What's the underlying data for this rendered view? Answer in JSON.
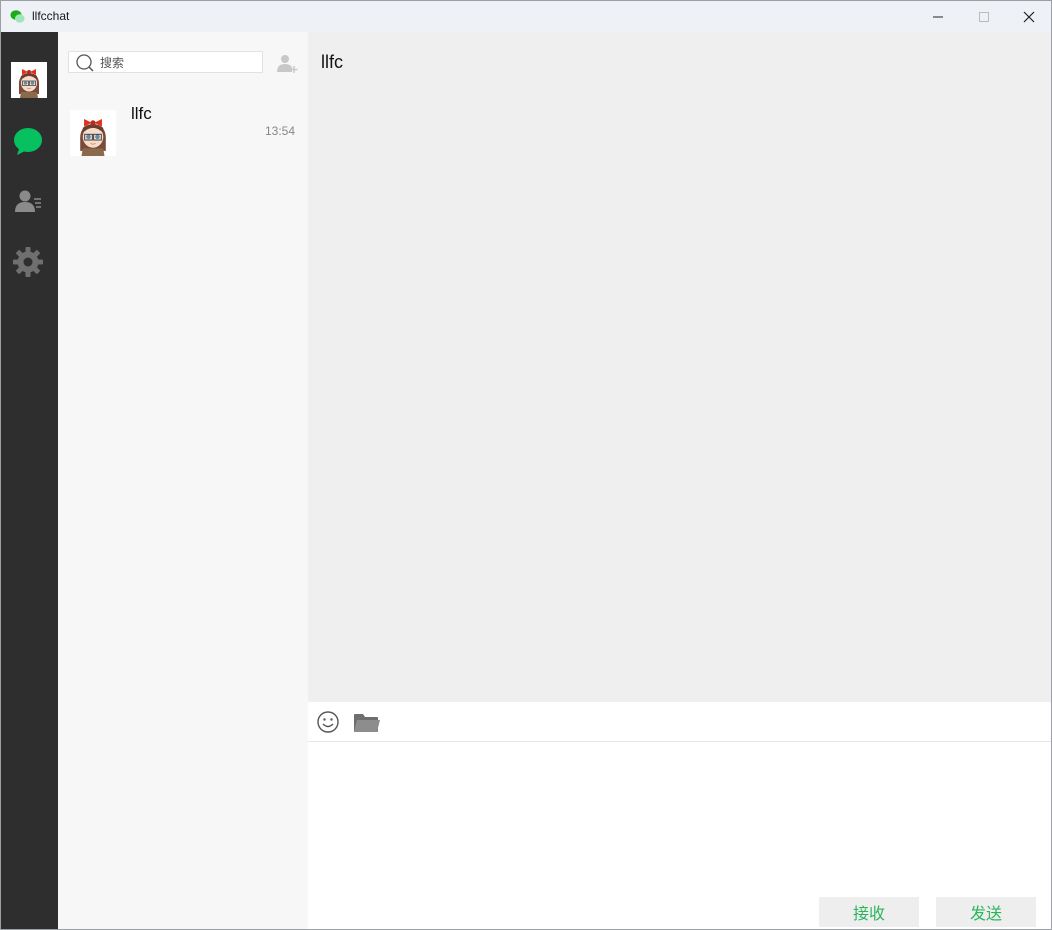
{
  "window": {
    "title": "llfcchat"
  },
  "icons": {
    "app": "chat-bubbles-icon",
    "minimize": "minimize-icon",
    "maximize": "maximize-icon",
    "close": "close-icon",
    "chat": "chat-bubble-icon",
    "contacts": "contacts-icon",
    "settings": "gear-icon",
    "search": "search-icon",
    "add_friend": "add-user-icon",
    "emoji": "emoji-icon",
    "folder": "folder-icon"
  },
  "colors": {
    "nav_bg": "#2e2e2e",
    "accent_green": "#07c160",
    "button_text": "#2bb55b"
  },
  "search": {
    "placeholder": "搜索"
  },
  "sessions": [
    {
      "name": "llfc",
      "time": "13:54"
    }
  ],
  "chat": {
    "title": "llfc"
  },
  "buttons": {
    "receive": "接收",
    "send": "发送"
  }
}
